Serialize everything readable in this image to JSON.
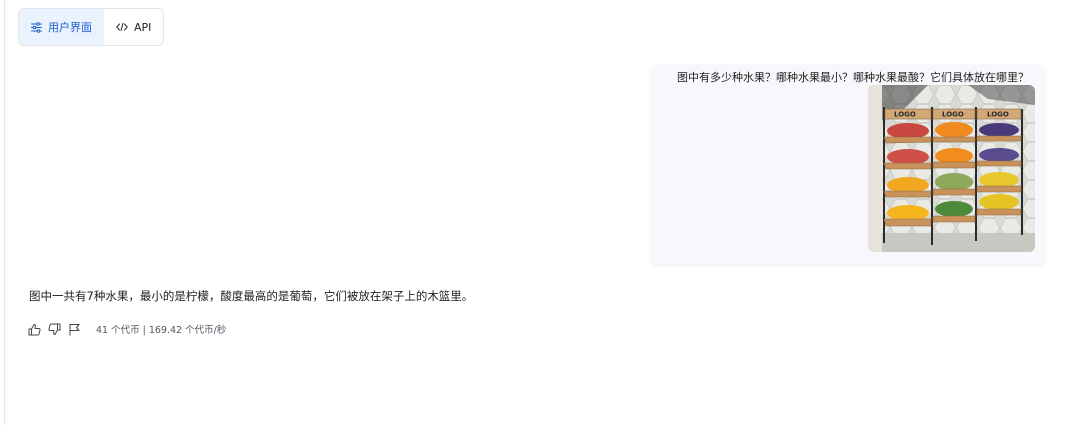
{
  "tabs": [
    {
      "label": "用户界面",
      "icon": "sliders-icon",
      "active": true
    },
    {
      "label": "API",
      "icon": "code-icon",
      "active": false
    }
  ],
  "user_message": {
    "text": "图中有多少种水果？哪种水果最小？哪种水果最酸？它们具体放在哪里？",
    "image_labels": [
      "LOGO",
      "LOGO",
      "LOGO"
    ]
  },
  "assistant_message": {
    "text": "图中一共有7种水果，最小的是柠檬，酸度最高的是葡萄，它们被放在架子上的木篮里。",
    "stats": "41 个代币 | 169.42 个代币/秒"
  },
  "colors": {
    "accent": "#1a5fd0",
    "active_tab_bg": "#eaf2fd",
    "bubble_bg": "#f6f8fb"
  }
}
